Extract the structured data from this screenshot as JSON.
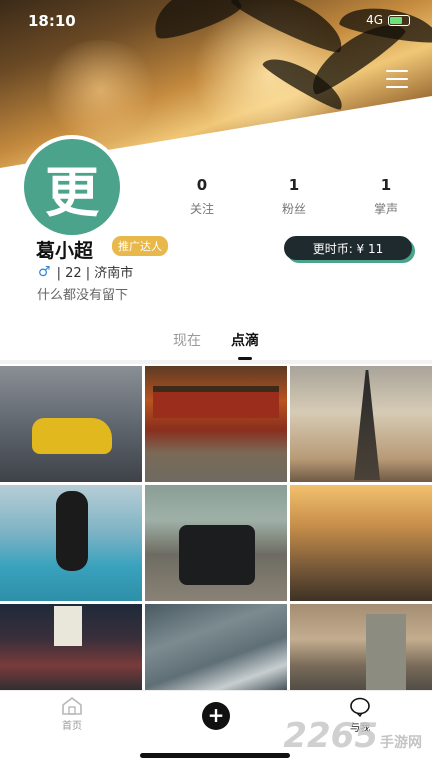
{
  "status_bar": {
    "time": "18:10",
    "network": "4G"
  },
  "profile": {
    "avatar_char": "更",
    "name": "葛小超",
    "badge": "推广达人",
    "gender_symbol": "♂",
    "age_city": "| 22 | 济南市",
    "bio": "什么都没有留下",
    "coins": "更时币: ¥ 11"
  },
  "stats": [
    {
      "value": "0",
      "label": "关注"
    },
    {
      "value": "1",
      "label": "粉丝"
    },
    {
      "value": "1",
      "label": "掌声"
    }
  ],
  "tabs": [
    {
      "label": "现在",
      "active": false
    },
    {
      "label": "点滴",
      "active": true
    }
  ],
  "grid": {
    "tiles": [
      {
        "icon": "photo-sports-car"
      },
      {
        "icon": "photo-forbidden-city"
      },
      {
        "icon": "photo-eiffel-tower"
      },
      {
        "icon": "photo-car-key"
      },
      {
        "icon": "photo-suv"
      },
      {
        "icon": "photo-palm-street"
      },
      {
        "icon": "photo-night-street"
      },
      {
        "icon": "photo-ocean-aerial"
      },
      {
        "icon": "photo-railway"
      }
    ]
  },
  "nav": {
    "home_label": "首页",
    "add_label": "+",
    "me_label": "与我"
  },
  "watermark": {
    "big": "2265",
    "small": "手游网"
  },
  "colors": {
    "accent": "#4aa38a",
    "badge": "#e8b84a",
    "coin_bg": "#1f2a2e"
  }
}
